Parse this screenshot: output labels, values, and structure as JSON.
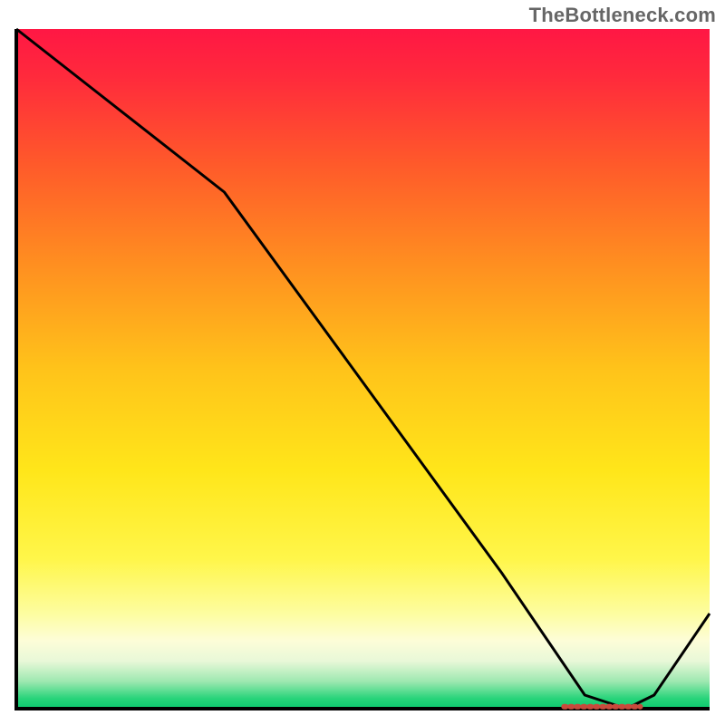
{
  "watermark": "TheBottleneck.com",
  "chart_data": {
    "type": "line",
    "title": "",
    "xlabel": "",
    "ylabel": "",
    "xlim": [
      0,
      100
    ],
    "ylim": [
      0,
      100
    ],
    "series": [
      {
        "name": "curve",
        "x": [
          0,
          10,
          25,
          30,
          40,
          50,
          60,
          70,
          78,
          82,
          88,
          92,
          100
        ],
        "values": [
          100,
          92,
          80,
          76,
          62,
          48,
          34,
          20,
          8,
          2,
          0,
          2,
          14
        ]
      }
    ],
    "marker": {
      "x_start": 79,
      "x_end": 90,
      "y": 0.3
    },
    "background_gradient": {
      "stops": [
        {
          "offset": 0.0,
          "color": "#ff1744"
        },
        {
          "offset": 0.07,
          "color": "#ff2a3c"
        },
        {
          "offset": 0.2,
          "color": "#ff5a2a"
        },
        {
          "offset": 0.35,
          "color": "#ff9020"
        },
        {
          "offset": 0.5,
          "color": "#ffc31a"
        },
        {
          "offset": 0.65,
          "color": "#ffe61a"
        },
        {
          "offset": 0.78,
          "color": "#fff64a"
        },
        {
          "offset": 0.86,
          "color": "#fdfda0"
        },
        {
          "offset": 0.9,
          "color": "#fdfdd8"
        },
        {
          "offset": 0.93,
          "color": "#e8f8d8"
        },
        {
          "offset": 0.96,
          "color": "#9de8b0"
        },
        {
          "offset": 0.985,
          "color": "#28d47a"
        },
        {
          "offset": 1.0,
          "color": "#0ac96e"
        }
      ]
    },
    "axis_color": "#000000",
    "line_color": "#000000",
    "marker_color": "#c84a3c"
  }
}
